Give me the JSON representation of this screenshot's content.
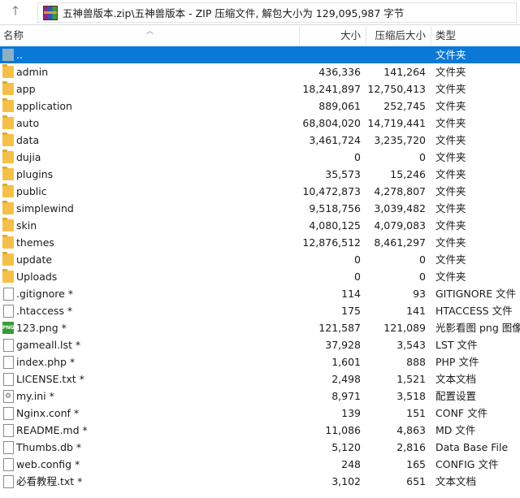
{
  "pathbar": {
    "up_icon": "up-arrow-icon",
    "archive_icon": "winrar-archive-icon",
    "path": "五神兽版本.zip\\五神兽版本 - ZIP 压缩文件, 解包大小为 129,095,987 字节"
  },
  "columns": {
    "name": "名称",
    "size": "大小",
    "packed": "压缩后大小",
    "type": "类型"
  },
  "rows": [
    {
      "name": "..",
      "size": "",
      "packed": "",
      "type": "文件夹",
      "icon": "parent-folder-icon",
      "kind": "up"
    },
    {
      "name": "admin",
      "size": "436,336",
      "packed": "141,264",
      "type": "文件夹",
      "icon": "folder-icon",
      "kind": "folder"
    },
    {
      "name": "app",
      "size": "18,241,897",
      "packed": "12,750,413",
      "type": "文件夹",
      "icon": "folder-icon",
      "kind": "folder"
    },
    {
      "name": "application",
      "size": "889,061",
      "packed": "252,745",
      "type": "文件夹",
      "icon": "folder-icon",
      "kind": "folder"
    },
    {
      "name": "auto",
      "size": "68,804,020",
      "packed": "14,719,441",
      "type": "文件夹",
      "icon": "folder-icon",
      "kind": "folder"
    },
    {
      "name": "data",
      "size": "3,461,724",
      "packed": "3,235,720",
      "type": "文件夹",
      "icon": "folder-icon",
      "kind": "folder"
    },
    {
      "name": "dujia",
      "size": "0",
      "packed": "0",
      "type": "文件夹",
      "icon": "folder-icon",
      "kind": "folder"
    },
    {
      "name": "plugins",
      "size": "35,573",
      "packed": "15,246",
      "type": "文件夹",
      "icon": "folder-icon",
      "kind": "folder"
    },
    {
      "name": "public",
      "size": "10,472,873",
      "packed": "4,278,807",
      "type": "文件夹",
      "icon": "folder-icon",
      "kind": "folder"
    },
    {
      "name": "simplewind",
      "size": "9,518,756",
      "packed": "3,039,482",
      "type": "文件夹",
      "icon": "folder-icon",
      "kind": "folder"
    },
    {
      "name": "skin",
      "size": "4,080,125",
      "packed": "4,079,083",
      "type": "文件夹",
      "icon": "folder-icon",
      "kind": "folder"
    },
    {
      "name": "themes",
      "size": "12,876,512",
      "packed": "8,461,297",
      "type": "文件夹",
      "icon": "folder-icon",
      "kind": "folder"
    },
    {
      "name": "update",
      "size": "0",
      "packed": "0",
      "type": "文件夹",
      "icon": "folder-icon",
      "kind": "folder"
    },
    {
      "name": "Uploads",
      "size": "0",
      "packed": "0",
      "type": "文件夹",
      "icon": "folder-icon",
      "kind": "folder"
    },
    {
      "name": ".gitignore *",
      "size": "114",
      "packed": "93",
      "type": "GITIGNORE 文件",
      "icon": "file-icon",
      "kind": "file"
    },
    {
      "name": ".htaccess *",
      "size": "175",
      "packed": "141",
      "type": "HTACCESS 文件",
      "icon": "file-icon",
      "kind": "file"
    },
    {
      "name": "123.png *",
      "size": "121,587",
      "packed": "121,089",
      "type": "光影看图 png 图像",
      "icon": "png-image-icon",
      "kind": "png"
    },
    {
      "name": "gameall.lst *",
      "size": "37,928",
      "packed": "3,543",
      "type": "LST 文件",
      "icon": "file-icon",
      "kind": "file"
    },
    {
      "name": "index.php *",
      "size": "1,601",
      "packed": "888",
      "type": "PHP 文件",
      "icon": "file-icon",
      "kind": "file"
    },
    {
      "name": "LICENSE.txt *",
      "size": "2,498",
      "packed": "1,521",
      "type": "文本文档",
      "icon": "text-file-icon",
      "kind": "file"
    },
    {
      "name": "my.ini *",
      "size": "8,971",
      "packed": "3,518",
      "type": "配置设置",
      "icon": "settings-file-icon",
      "kind": "ini"
    },
    {
      "name": "Nginx.conf *",
      "size": "139",
      "packed": "151",
      "type": "CONF 文件",
      "icon": "file-icon",
      "kind": "file"
    },
    {
      "name": "README.md *",
      "size": "11,086",
      "packed": "4,863",
      "type": "MD 文件",
      "icon": "file-icon",
      "kind": "file"
    },
    {
      "name": "Thumbs.db *",
      "size": "5,120",
      "packed": "2,816",
      "type": "Data Base File",
      "icon": "file-icon",
      "kind": "file"
    },
    {
      "name": "web.config *",
      "size": "248",
      "packed": "165",
      "type": "CONFIG 文件",
      "icon": "file-icon",
      "kind": "file"
    },
    {
      "name": "必看教程.txt *",
      "size": "3,102",
      "packed": "651",
      "type": "文本文档",
      "icon": "text-file-icon",
      "kind": "file"
    }
  ],
  "selected_index": 0,
  "colors": {
    "selection": "#0a78d7",
    "folder": "#f5c04a"
  }
}
